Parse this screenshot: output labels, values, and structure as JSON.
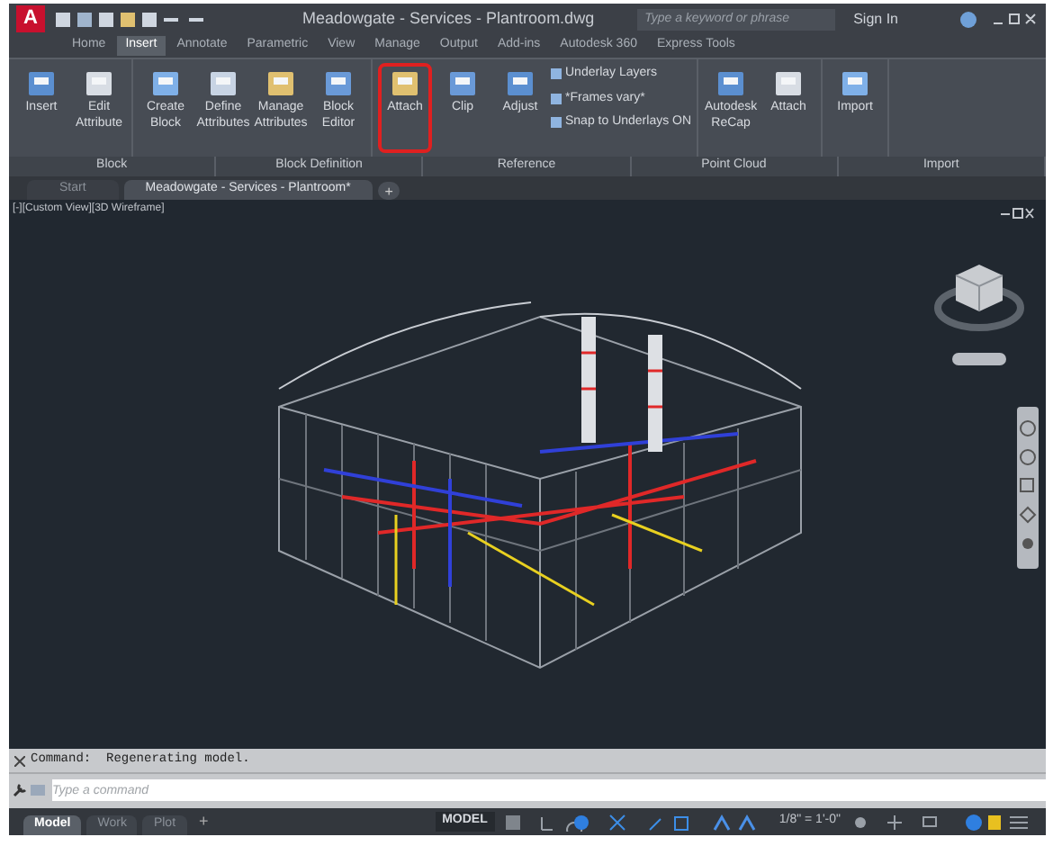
{
  "app": {
    "logo": "A",
    "title": "Meadowgate - Services - Plantroom.dwg",
    "search": {
      "placeholder": "Type a keyword or phrase"
    },
    "sign_in": "Sign In"
  },
  "ribbon_tabs": [
    {
      "label": "Home",
      "selected": false
    },
    {
      "label": "Insert",
      "selected": true
    },
    {
      "label": "Annotate",
      "selected": false
    },
    {
      "label": "Parametric",
      "selected": false
    },
    {
      "label": "View",
      "selected": false
    },
    {
      "label": "Manage",
      "selected": false
    },
    {
      "label": "Output",
      "selected": false
    },
    {
      "label": "Add-ins",
      "selected": false
    },
    {
      "label": "Autodesk 360",
      "selected": false
    },
    {
      "label": "Express Tools",
      "selected": false
    }
  ],
  "ribbon_panels": [
    {
      "title": "Block",
      "buttons": [
        {
          "label": "Insert",
          "highlighted": false
        },
        {
          "label": "Edit Attribute",
          "highlighted": false
        }
      ]
    },
    {
      "title": "Block Definition",
      "buttons": [
        {
          "label": "Create Block",
          "highlighted": false
        },
        {
          "label": "Define Attributes",
          "highlighted": false
        },
        {
          "label": "Manage Attributes",
          "highlighted": false
        },
        {
          "label": "Block Editor",
          "highlighted": false
        }
      ]
    },
    {
      "title": "Reference",
      "buttons": [
        {
          "label": "Attach",
          "highlighted": true
        },
        {
          "label": "Clip",
          "highlighted": false
        },
        {
          "label": "Adjust",
          "highlighted": false
        }
      ],
      "links": [
        "Underlay Layers",
        "*Frames vary*",
        "Snap to Underlays ON"
      ]
    },
    {
      "title": "Point Cloud",
      "buttons": [
        {
          "label": "Autodesk ReCap",
          "highlighted": false
        },
        {
          "label": "Attach",
          "highlighted": false
        }
      ]
    },
    {
      "title": "Import",
      "buttons": [
        {
          "label": "Import",
          "highlighted": false
        }
      ]
    }
  ],
  "file_tabs": [
    {
      "label": "Start",
      "selected": false
    },
    {
      "label": "Meadowgate - Services - Plantroom*",
      "selected": true
    }
  ],
  "new_tab_button": "+",
  "viewport": {
    "label": "[-][Custom View][3D Wireframe]"
  },
  "command": {
    "history": "Command:  Regenerating model.",
    "placeholder": "Type a command"
  },
  "layout_tabs": [
    {
      "label": "Model",
      "selected": true
    },
    {
      "label": "Work",
      "selected": false
    },
    {
      "label": "Plot",
      "selected": false
    }
  ],
  "add_layout_button": "+",
  "status_bar": {
    "mode": "MODEL",
    "scale": "1/8\" = 1'-0\""
  }
}
